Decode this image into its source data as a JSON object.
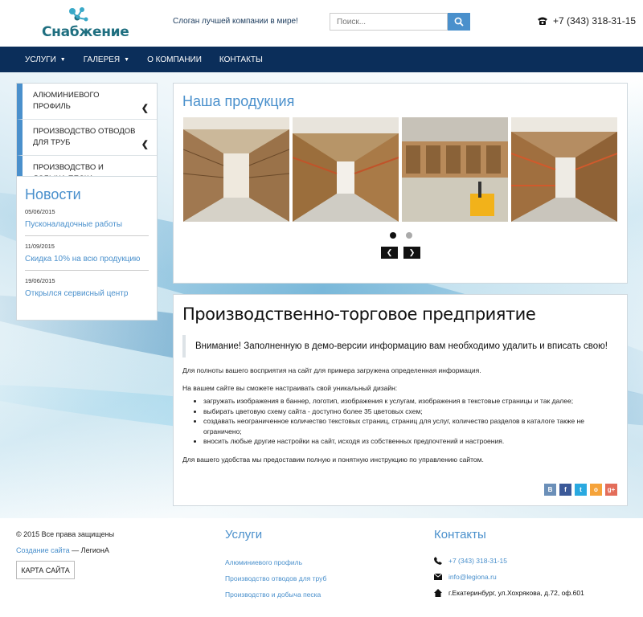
{
  "header": {
    "logo_text": "Снабжение",
    "slogan": "Слоган лучшей компании в мире!",
    "search_placeholder": "Поиск...",
    "phone": "+7 (343) 318-31-15"
  },
  "nav": [
    {
      "label": "Услуги",
      "has_caret": true
    },
    {
      "label": "Галерея",
      "has_caret": true
    },
    {
      "label": "О компании",
      "has_caret": false
    },
    {
      "label": "Контакты",
      "has_caret": false
    }
  ],
  "caret_glyph": "▼",
  "sidebar": {
    "items": [
      {
        "label": "Алюминиевого профиль"
      },
      {
        "label": "Производство отводов для труб"
      },
      {
        "label": "Производство и добыча песка"
      }
    ],
    "chevron": "❮"
  },
  "news": {
    "title": "Новости",
    "items": [
      {
        "date": "05/06/2015",
        "title": "Пусконаладочные работы"
      },
      {
        "date": "11/09/2015",
        "title": "Скидка 10% на всю продукцию"
      },
      {
        "date": "19/06/2015",
        "title": "Открылся сервисный центр"
      }
    ]
  },
  "products": {
    "title": "Наша продукция",
    "slides_total": 2,
    "slide_active": 1,
    "prev_glyph": "❮",
    "next_glyph": "❯"
  },
  "content": {
    "heading": "Производственно-торговое предприятие",
    "notice": "Внимание! Заполненную в демо-версии информацию вам необходимо удалить и вписать свою!",
    "p1": "Для полноты вашего восприятия на сайт для примера загружена определенная информация.",
    "p2": "На вашем сайте вы сможете настраивать свой уникальный дизайн:",
    "list": [
      "загружать изображения в баннер, логотип, изображения к услугам, изображения в текстовые страницы и так далее;",
      "выбирать цветовую схему сайта - доступно более 35 цветовых схем;",
      "создавать неограниченное количество текстовых страниц, страниц для услуг, количество разделов в каталоге также не ограничено;",
      "вносить любые другие настройки на сайт, исходя из собственных предпочтений и настроения."
    ],
    "p3": "Для вашего удобства мы предоставим полную и понятную инструкцию по управлению сайтом.",
    "share": [
      {
        "label": "В",
        "color": "#6b8fb8",
        "icon": "vk-icon"
      },
      {
        "label": "f",
        "color": "#3b5998",
        "icon": "facebook-icon"
      },
      {
        "label": "t",
        "color": "#2aa9e0",
        "icon": "twitter-icon"
      },
      {
        "label": "о",
        "color": "#f5a33a",
        "icon": "odnoklassniki-icon"
      },
      {
        "label": "g+",
        "color": "#e36d5a",
        "icon": "google-plus-icon"
      }
    ]
  },
  "footer": {
    "copyright": "© 2015 Все права защищены",
    "made_link": "Создание сайта",
    "made_by": " — ЛегионА",
    "sitemap": "Карта сайта",
    "services_title": "Услуги",
    "services": [
      "Алюминиевого профиль",
      "Производство отводов для труб",
      "Производство и добыча песка"
    ],
    "contacts_title": "Контакты",
    "contacts": {
      "phone": "+7 (343) 318-31-15",
      "email": "info@legiona.ru",
      "address": "г.Екатеринбург, ул.Хохрякова, д.72, оф.601"
    }
  },
  "colors": {
    "accent": "#4a90cc",
    "nav_bg": "#0b2e5a",
    "logo": "#1f6f80"
  }
}
